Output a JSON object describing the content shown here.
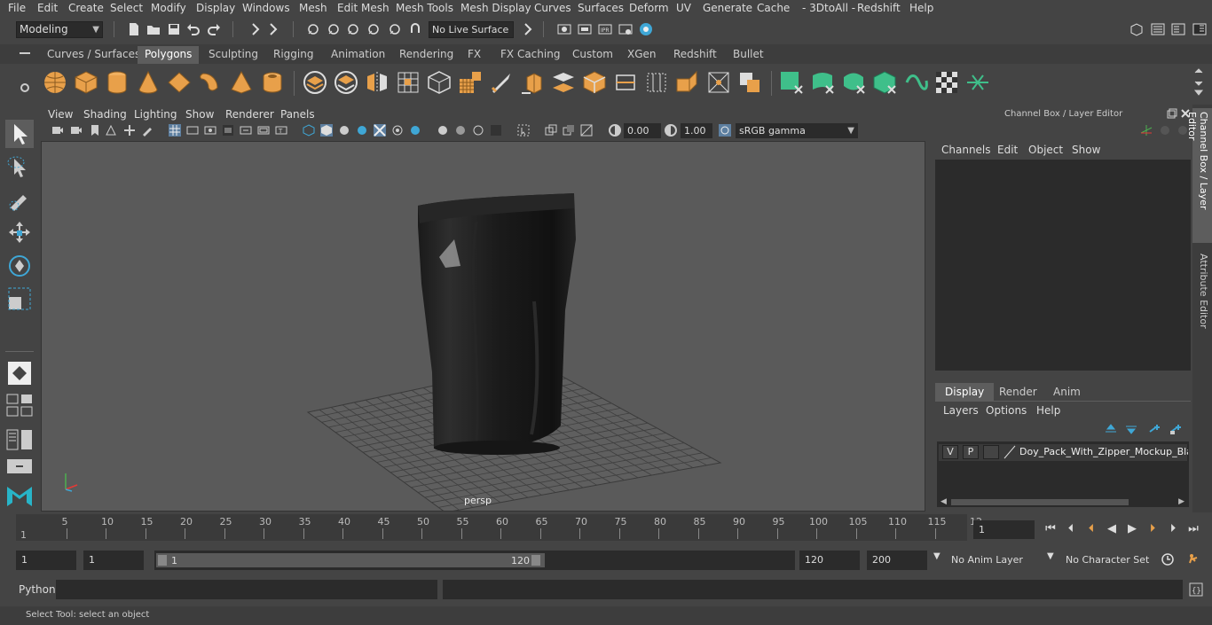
{
  "menubar": {
    "items": [
      "File",
      "Edit",
      "Create",
      "Select",
      "Modify",
      "Display",
      "Windows",
      "Mesh",
      "Edit Mesh",
      "Mesh Tools",
      "Mesh Display",
      "Curves",
      "Surfaces",
      "Deform",
      "UV",
      "Generate",
      "Cache",
      "- 3DtoAll -",
      "Redshift",
      "Help"
    ]
  },
  "statusline": {
    "mode": "Modeling",
    "live_surface": "No Live Surface"
  },
  "shelf": {
    "tabs": [
      "Curves / Surfaces",
      "Polygons",
      "Sculpting",
      "Rigging",
      "Animation",
      "Rendering",
      "FX",
      "FX Caching",
      "Custom",
      "XGen",
      "Redshift",
      "Bullet"
    ],
    "active_tab": "Polygons"
  },
  "viewport": {
    "menu": [
      "View",
      "Shading",
      "Lighting",
      "Show",
      "Renderer",
      "Panels"
    ],
    "exposure": "0.00",
    "gamma_value": "1.00",
    "color_space": "sRGB gamma",
    "camera_label": "persp"
  },
  "channel_box": {
    "title": "Channel Box / Layer Editor",
    "menu": [
      "Channels",
      "Edit",
      "Object",
      "Show"
    ]
  },
  "layer_editor": {
    "tabs": [
      "Display",
      "Render",
      "Anim"
    ],
    "active_tab": "Display",
    "menu": [
      "Layers",
      "Options",
      "Help"
    ],
    "layer": {
      "visible": "V",
      "playback": "P",
      "name": "Doy_Pack_With_Zipper_Mockup_Blac"
    }
  },
  "side_tabs": [
    "Channel Box / Layer Editor",
    "Attribute Editor"
  ],
  "timeline": {
    "ticks": [
      "1",
      "5",
      "10",
      "15",
      "20",
      "25",
      "30",
      "35",
      "40",
      "45",
      "50",
      "55",
      "60",
      "65",
      "70",
      "75",
      "80",
      "85",
      "90",
      "95",
      "100",
      "105",
      "110",
      "115",
      "12"
    ],
    "current_frame": "1"
  },
  "range": {
    "start": "1",
    "playback_start": "1",
    "slider_start": "1",
    "slider_end": "120",
    "playback_end": "120",
    "end": "200",
    "anim_layer": "No Anim Layer",
    "character_set": "No Character Set"
  },
  "command_line": {
    "label": "Python"
  },
  "help_line": {
    "text": "Select Tool: select an object"
  },
  "colors": {
    "shelf_orange": "#e8a04a",
    "shelf_green": "#3fbf8a",
    "active_tab": "#5d5d5d",
    "field_bg": "#2b2b2b"
  }
}
